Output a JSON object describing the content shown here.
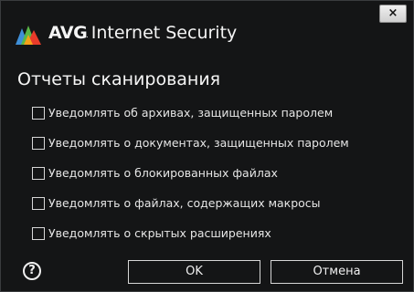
{
  "window": {
    "brand_bold": "AVG",
    "brand_dot": ".",
    "brand_name": "Internet Security",
    "close_label": "×",
    "logo_colors": [
      "#3f8fd8",
      "#e93b2a",
      "#f6a21b",
      "#5ab848"
    ]
  },
  "dialog": {
    "heading": "Отчеты сканирования",
    "options": [
      {
        "label": "Уведомлять об архивах, защищенных паролем",
        "checked": false
      },
      {
        "label": "Уведомлять о документах, защищенных паролем",
        "checked": false
      },
      {
        "label": "Уведомлять о блокированных файлах",
        "checked": false
      },
      {
        "label": "Уведомлять о файлах, содержащих макросы",
        "checked": false
      },
      {
        "label": "Уведомлять о скрытых расширениях",
        "checked": false
      }
    ]
  },
  "footer": {
    "help_icon": "question-circle-icon",
    "help_glyph": "?",
    "ok_label": "OK",
    "cancel_label": "Отмена"
  }
}
